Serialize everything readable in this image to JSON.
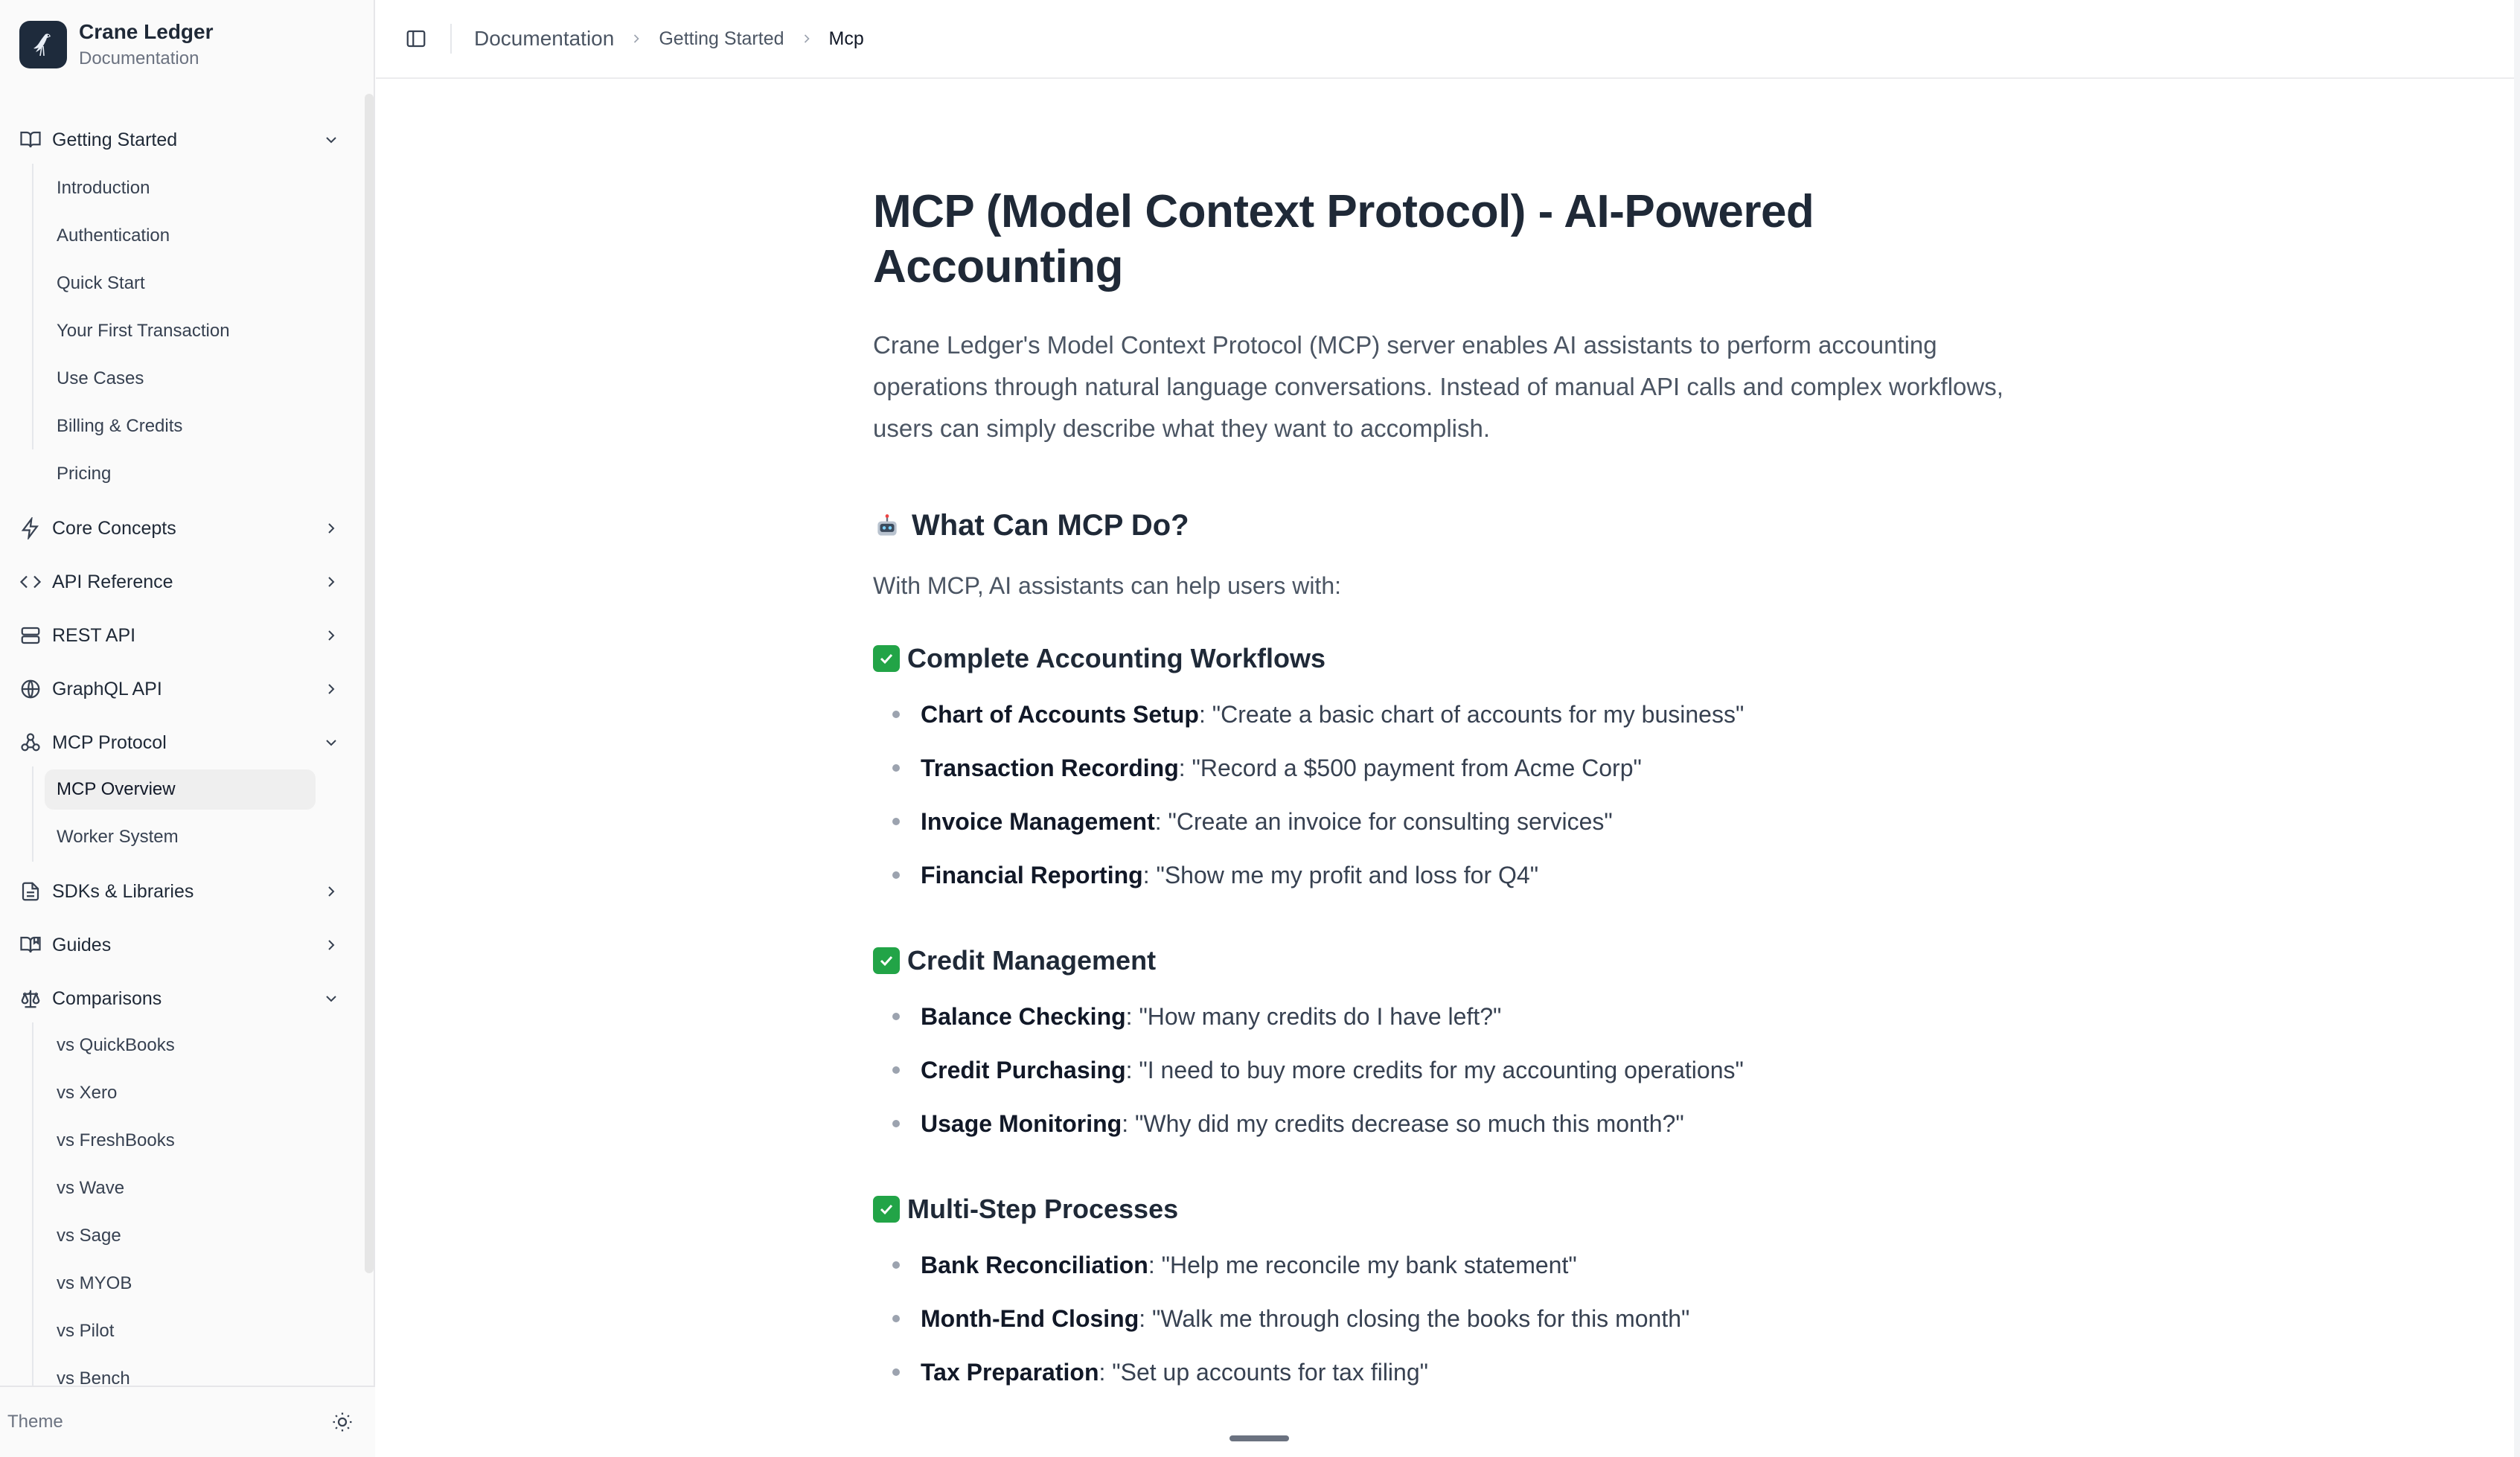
{
  "brand": {
    "name": "Crane Ledger",
    "subtitle": "Documentation"
  },
  "nav": {
    "getting_started": {
      "label": "Getting Started",
      "items": [
        "Introduction",
        "Authentication",
        "Quick Start",
        "Your First Transaction",
        "Use Cases",
        "Billing & Credits",
        "Pricing"
      ]
    },
    "core_concepts": {
      "label": "Core Concepts"
    },
    "api_reference": {
      "label": "API Reference"
    },
    "rest_api": {
      "label": "REST API"
    },
    "graphql_api": {
      "label": "GraphQL API"
    },
    "mcp_protocol": {
      "label": "MCP Protocol",
      "items": [
        "MCP Overview",
        "Worker System"
      ],
      "active": "MCP Overview"
    },
    "sdks": {
      "label": "SDKs & Libraries"
    },
    "guides": {
      "label": "Guides"
    },
    "comparisons": {
      "label": "Comparisons",
      "items": [
        "vs QuickBooks",
        "vs Xero",
        "vs FreshBooks",
        "vs Wave",
        "vs Sage",
        "vs MYOB",
        "vs Pilot",
        "vs Bench"
      ]
    }
  },
  "theme": {
    "label": "Theme",
    "icon": "sun-icon"
  },
  "breadcrumb": [
    "Documentation",
    "Getting Started",
    "Mcp"
  ],
  "article": {
    "title": "MCP (Model Context Protocol) - AI-Powered Accounting",
    "intro": "Crane Ledger's Model Context Protocol (MCP) server enables AI assistants to perform accounting operations through natural language conversations. Instead of manual API calls and complex workflows, users can simply describe what they want to accomplish.",
    "section_title": "What Can MCP Do?",
    "section_text": "With MCP, AI assistants can help users with:",
    "groups": [
      {
        "heading": "Complete Accounting Workflows",
        "items": [
          {
            "term": "Chart of Accounts Setup",
            "text": ": \"Create a basic chart of accounts for my business\""
          },
          {
            "term": "Transaction Recording",
            "text": ": \"Record a $500 payment from Acme Corp\""
          },
          {
            "term": "Invoice Management",
            "text": ": \"Create an invoice for consulting services\""
          },
          {
            "term": "Financial Reporting",
            "text": ": \"Show me my profit and loss for Q4\""
          }
        ]
      },
      {
        "heading": "Credit Management",
        "items": [
          {
            "term": "Balance Checking",
            "text": ": \"How many credits do I have left?\""
          },
          {
            "term": "Credit Purchasing",
            "text": ": \"I need to buy more credits for my accounting operations\""
          },
          {
            "term": "Usage Monitoring",
            "text": ": \"Why did my credits decrease so much this month?\""
          }
        ]
      },
      {
        "heading": "Multi-Step Processes",
        "items": [
          {
            "term": "Bank Reconciliation",
            "text": ": \"Help me reconcile my bank statement\""
          },
          {
            "term": "Month-End Closing",
            "text": ": \"Walk me through closing the books for this month\""
          },
          {
            "term": "Tax Preparation",
            "text": ": \"Set up accounts for tax filing\""
          }
        ]
      }
    ]
  },
  "colors": {
    "check_green": "#22a447",
    "sidebar_bg": "#fafafa",
    "text_dark": "#1f2937"
  }
}
